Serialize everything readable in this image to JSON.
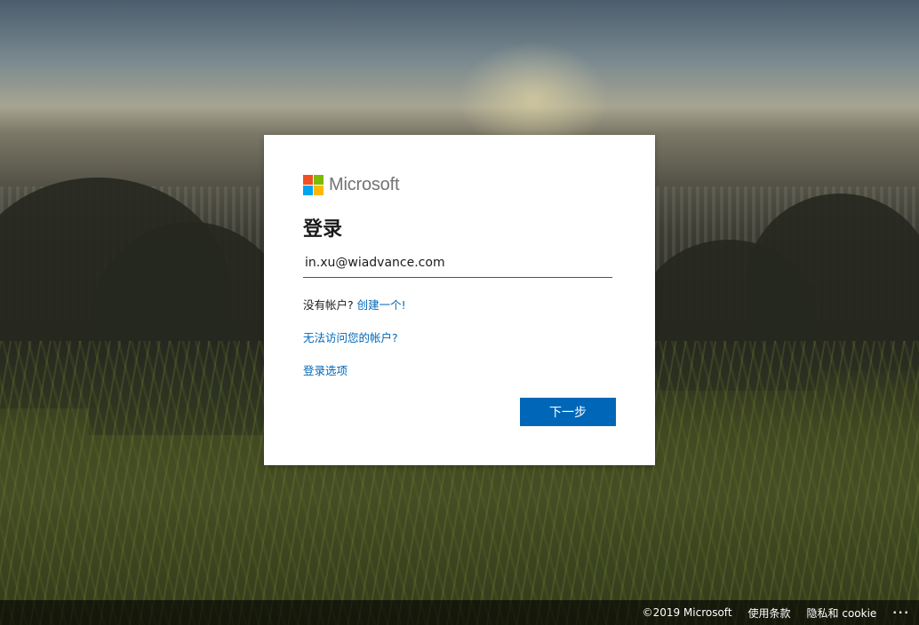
{
  "brand": {
    "name": "Microsoft"
  },
  "signin": {
    "title": "登录",
    "email_value": "in.xu@wiadvance.com",
    "no_account_text": "没有帐户?",
    "create_link": "创建一个!",
    "cant_access_link": "无法访问您的帐户?",
    "signin_options_link": "登录选项",
    "next_button": "下一步"
  },
  "footer": {
    "copyright": "©2019 Microsoft",
    "terms": "使用条款",
    "privacy": "隐私和 cookie",
    "more": "···"
  },
  "colors": {
    "accent": "#0067b8",
    "logo_red": "#f25022",
    "logo_green": "#7fba00",
    "logo_blue": "#00a4ef",
    "logo_yellow": "#ffb900"
  }
}
